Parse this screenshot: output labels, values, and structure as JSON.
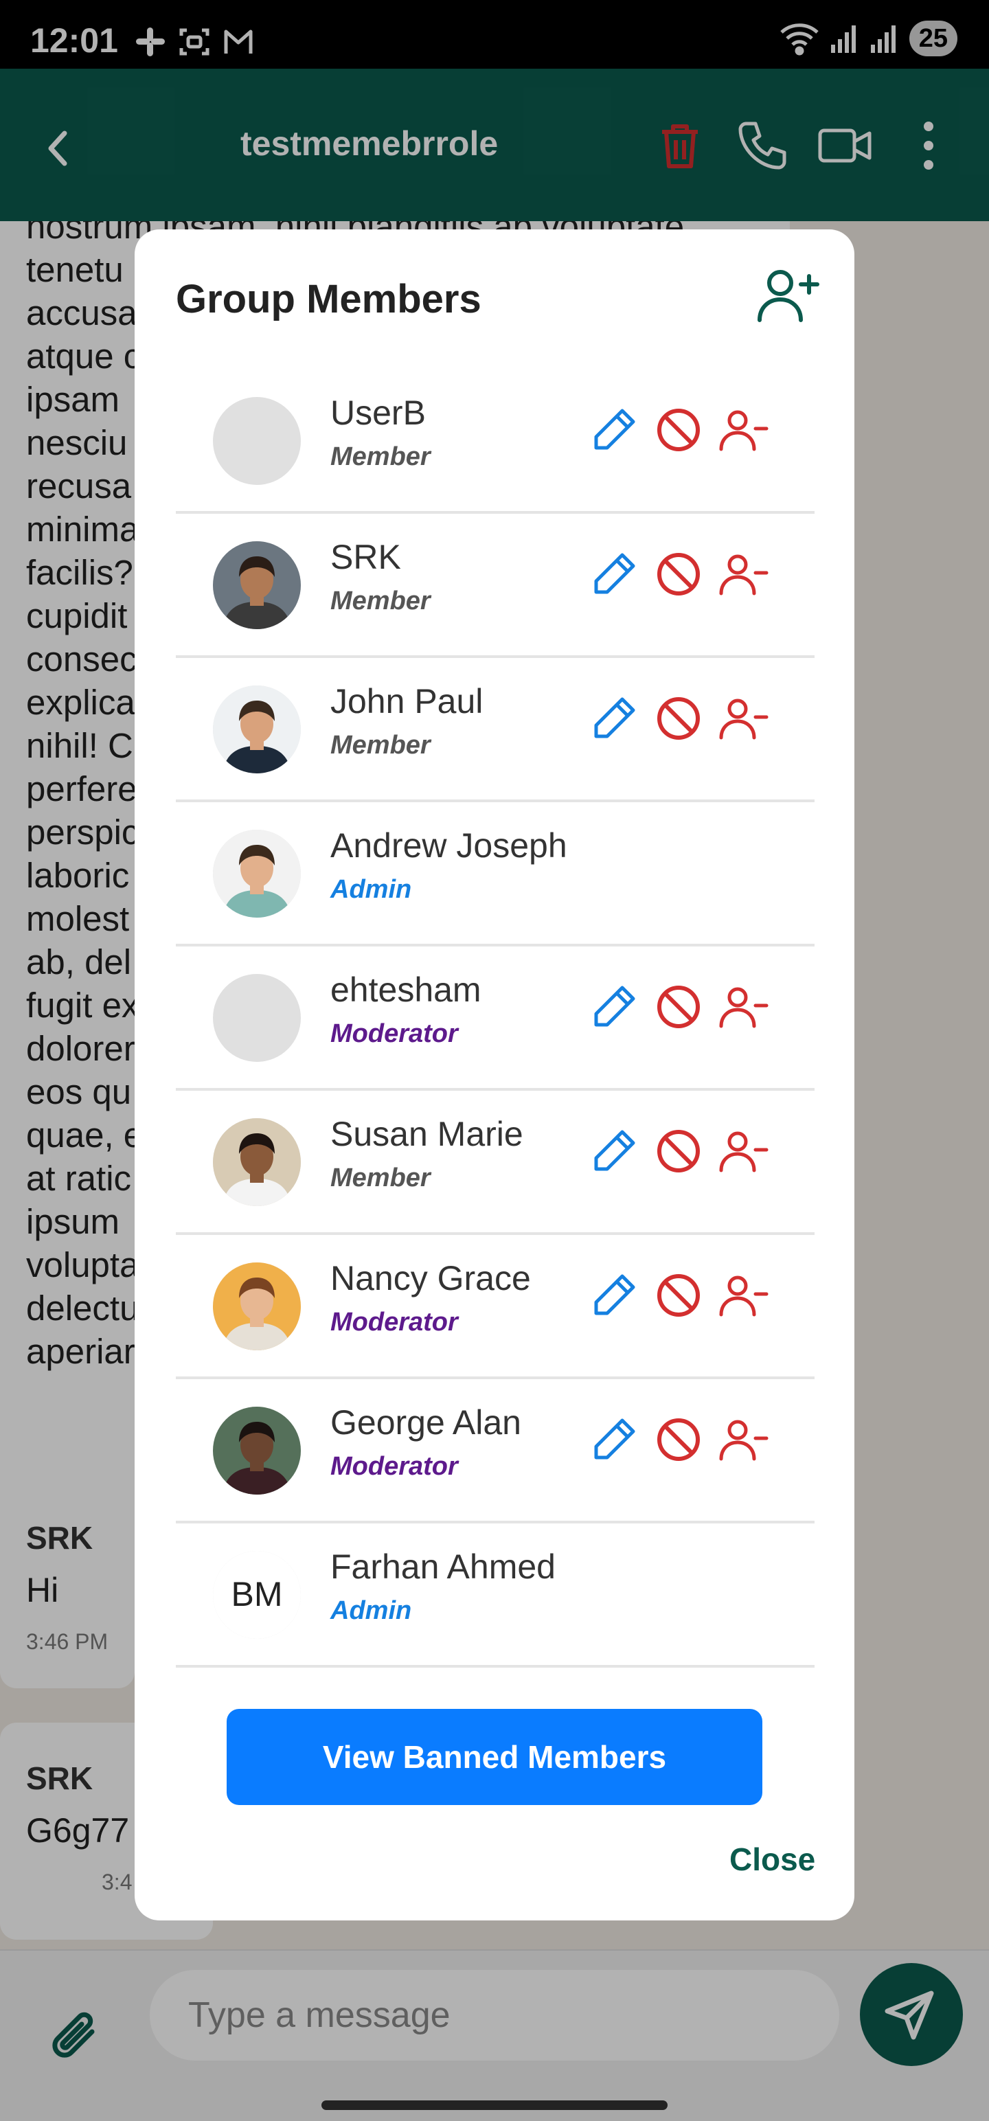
{
  "status_bar": {
    "time": "12:01",
    "battery": "25"
  },
  "header": {
    "title": "testmemebrrole"
  },
  "chat": {
    "long_message_lines": [
      "nostrum ipsam, nihil blanditiis ab voluptate",
      "tenetu",
      "accusa",
      "atque c",
      "ipsam",
      "nesciu",
      "recusa",
      "minima",
      "facilis?",
      "cupidit",
      "consec",
      "explica",
      "nihil! C",
      "perfere",
      "perspic",
      "laboric",
      "molest",
      "ab, del",
      "fugit ex",
      "dolorer",
      "eos qu",
      "quae, e",
      "at ratic",
      "ipsum",
      "volupta",
      "delectu",
      "aperiar"
    ],
    "bubble1": {
      "sender": "SRK",
      "text": "Hi",
      "time": "3:46 PM"
    },
    "bubble2": {
      "sender": "SRK",
      "text": "G6g77",
      "time": "3:4"
    }
  },
  "composer": {
    "placeholder": "Type a message"
  },
  "modal": {
    "title": "Group Members",
    "members": [
      {
        "name": "UserB",
        "role": "Member",
        "role_class": "member",
        "actions": true,
        "avatar": "blank"
      },
      {
        "name": "SRK",
        "role": "Member",
        "role_class": "member",
        "actions": true,
        "avatar": "photo-srk"
      },
      {
        "name": "John Paul",
        "role": "Member",
        "role_class": "member",
        "actions": true,
        "avatar": "photo-john"
      },
      {
        "name": "Andrew Joseph",
        "role": "Admin",
        "role_class": "admin",
        "actions": false,
        "avatar": "photo-andrew"
      },
      {
        "name": "ehtesham",
        "role": "Moderator",
        "role_class": "moderator",
        "actions": true,
        "avatar": "blank"
      },
      {
        "name": "Susan Marie",
        "role": "Member",
        "role_class": "member",
        "actions": true,
        "avatar": "photo-susan"
      },
      {
        "name": "Nancy Grace",
        "role": "Moderator",
        "role_class": "moderator",
        "actions": true,
        "avatar": "photo-nancy"
      },
      {
        "name": "George Alan",
        "role": "Moderator",
        "role_class": "moderator",
        "actions": true,
        "avatar": "photo-george"
      },
      {
        "name": "Farhan Ahmed",
        "role": "Admin",
        "role_class": "admin",
        "actions": false,
        "avatar": "logo-bm"
      }
    ],
    "avatar_logo_text": "BM",
    "view_banned_label": "View Banned Members",
    "close_label": "Close"
  },
  "colors": {
    "header": "#0b5a4d",
    "primary_button": "#0a7cff",
    "edit_icon": "#1580e0",
    "danger_icon": "#d32f2f",
    "admin_role": "#1580e0",
    "moderator_role": "#5d1a8c"
  }
}
